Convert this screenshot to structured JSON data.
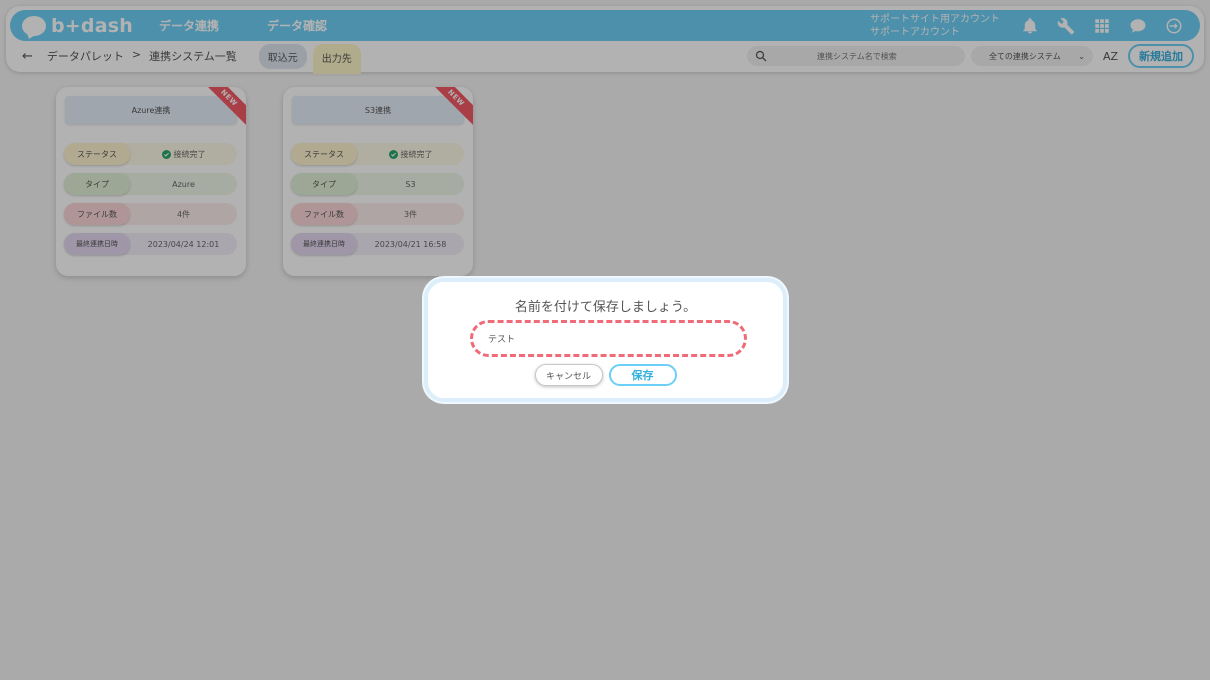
{
  "header": {
    "logo_text": "b+dash",
    "nav": [
      "データ連携",
      "データ確認"
    ],
    "account_line1": "サポートサイト用アカウント",
    "account_line2": "サポートアカウント",
    "icons": [
      "bell-icon",
      "wrench-icon",
      "grid-icon",
      "chat-icon",
      "logout-icon"
    ]
  },
  "subbar": {
    "back_label": "←",
    "breadcrumb": [
      "データパレット",
      ">",
      "連携システム一覧"
    ],
    "tab_in": "取込元",
    "tab_out": "出力先",
    "search_placeholder": "連携システム名で検索",
    "filter_value": "全ての連携システム",
    "sort_label": "AZ",
    "new_button": "新規追加"
  },
  "cards": [
    {
      "title": "Azure連携",
      "ribbon": "NEW",
      "status_label": "ステータス",
      "status_value": "接続完了",
      "type_label": "タイプ",
      "type_value": "Azure",
      "files_label": "ファイル数",
      "files_value": "4件",
      "date_label": "最終連携日時",
      "date_value": "2023/04/24 12:01"
    },
    {
      "title": "S3連携",
      "ribbon": "NEW",
      "status_label": "ステータス",
      "status_value": "接続完了",
      "type_label": "タイプ",
      "type_value": "S3",
      "files_label": "ファイル数",
      "files_value": "3件",
      "date_label": "最終連携日時",
      "date_value": "2023/04/21 16:58"
    }
  ],
  "modal": {
    "title": "名前を付けて保存しましょう。",
    "input_value": "テスト",
    "cancel_label": "キャンセル",
    "save_label": "保存"
  },
  "colors": {
    "accent": "#6ecff6",
    "ribbon": "#f35a66",
    "dashed_border": "#f06a78",
    "status_ok": "#2aa56b"
  }
}
